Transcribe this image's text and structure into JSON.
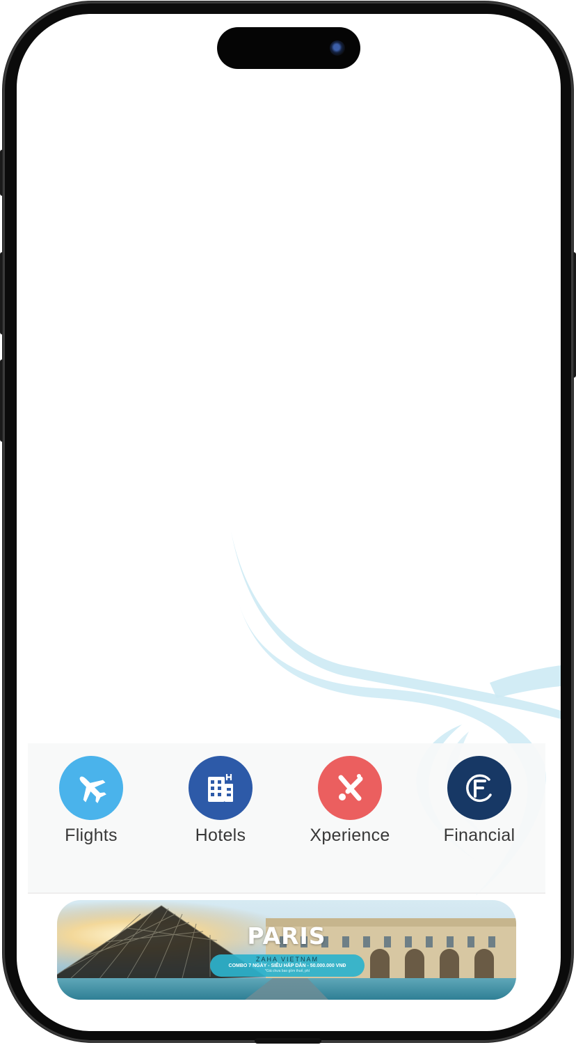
{
  "services": [
    {
      "label": "Flights",
      "icon": "airplane-icon",
      "color": "#4AB3EB"
    },
    {
      "label": "Hotels",
      "icon": "hotel-building-icon",
      "color": "#2D5AA8"
    },
    {
      "label": "Xperience",
      "icon": "xperience-icon",
      "color": "#EB5F5F"
    },
    {
      "label": "Financial",
      "icon": "financial-f-icon",
      "color": "#173865"
    }
  ],
  "banner": {
    "title": "PARIS",
    "brand": "ZAHA VIETNAM",
    "subtitle": "COMBO 7 NGÀY - SIÊU HẤP DẪN - 50.000.000 VNĐ",
    "note": "*Giá chưa bao gồm thuế, phí"
  },
  "colors": {
    "swoosh": "#CDEAF4",
    "panel_background": "#F7F8F9",
    "label_text": "#383838"
  }
}
